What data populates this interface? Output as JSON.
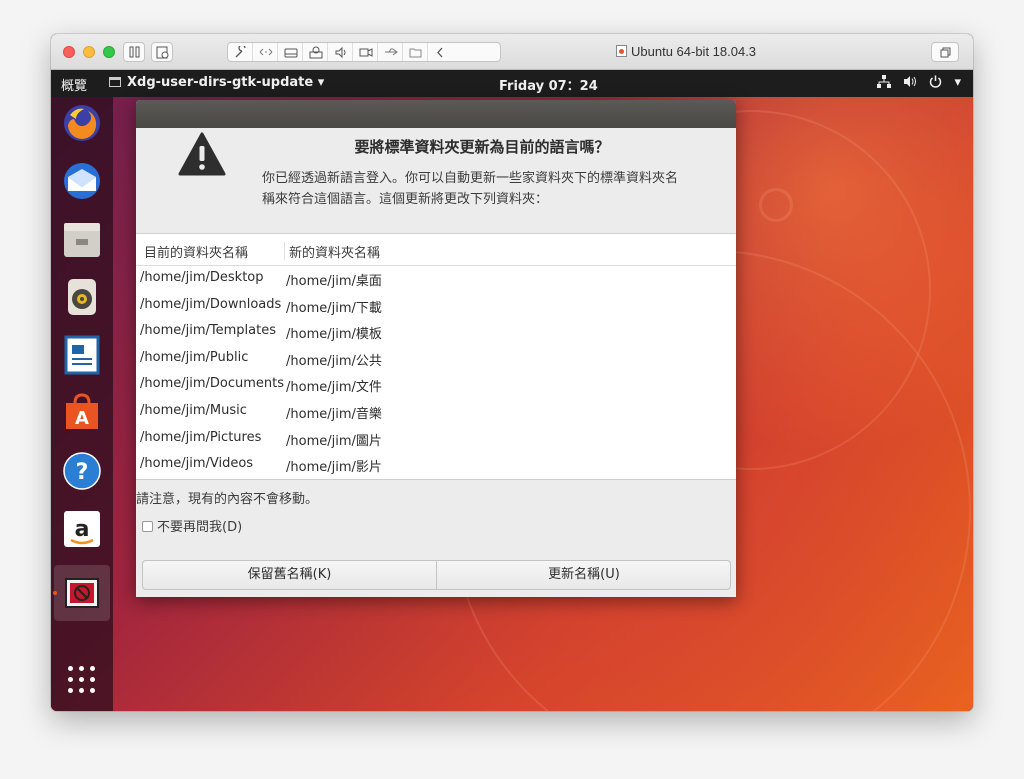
{
  "vm": {
    "title": "Ubuntu 64-bit 18.04.3"
  },
  "topbar": {
    "activities": "概覽",
    "app_menu": "Xdg-user-dirs-gtk-update ▾",
    "clock": "Friday 07：24",
    "power_menu_arrow": "▾"
  },
  "dock": {
    "items": [
      "firefox-icon",
      "thunderbird-icon",
      "files-icon",
      "rhythmbox-icon",
      "libreoffice-writer-icon",
      "ubuntu-software-icon",
      "help-icon",
      "amazon-icon",
      "xdg-user-dirs-update-icon"
    ],
    "accent_color": "#e95420"
  },
  "dialog": {
    "title": "要將標準資料夾更新為目前的語言嗎？",
    "message_line1": "你已經透過新語言登入。你可以自動更新一些家資料夾下的標準資料夾名",
    "message_line2": "稱來符合這個語言。這個更新將更改下列資料夾：",
    "table": {
      "col_current": "目前的資料夾名稱",
      "col_new": "新的資料夾名稱",
      "rows": [
        {
          "current": "/home/jim/Desktop",
          "new": "/home/jim/桌面"
        },
        {
          "current": "/home/jim/Downloads",
          "new": "/home/jim/下載"
        },
        {
          "current": "/home/jim/Templates",
          "new": "/home/jim/模板"
        },
        {
          "current": "/home/jim/Public",
          "new": "/home/jim/公共"
        },
        {
          "current": "/home/jim/Documents",
          "new": "/home/jim/文件"
        },
        {
          "current": "/home/jim/Music",
          "new": "/home/jim/音樂"
        },
        {
          "current": "/home/jim/Pictures",
          "new": "/home/jim/圖片"
        },
        {
          "current": "/home/jim/Videos",
          "new": "/home/jim/影片"
        }
      ]
    },
    "note": "請注意，現有的內容不會移動。",
    "dont_ask": {
      "label": "不要再問我(D)",
      "checked": false
    },
    "keep_button": "保留舊名稱(K)",
    "update_button": "更新名稱(U)"
  }
}
